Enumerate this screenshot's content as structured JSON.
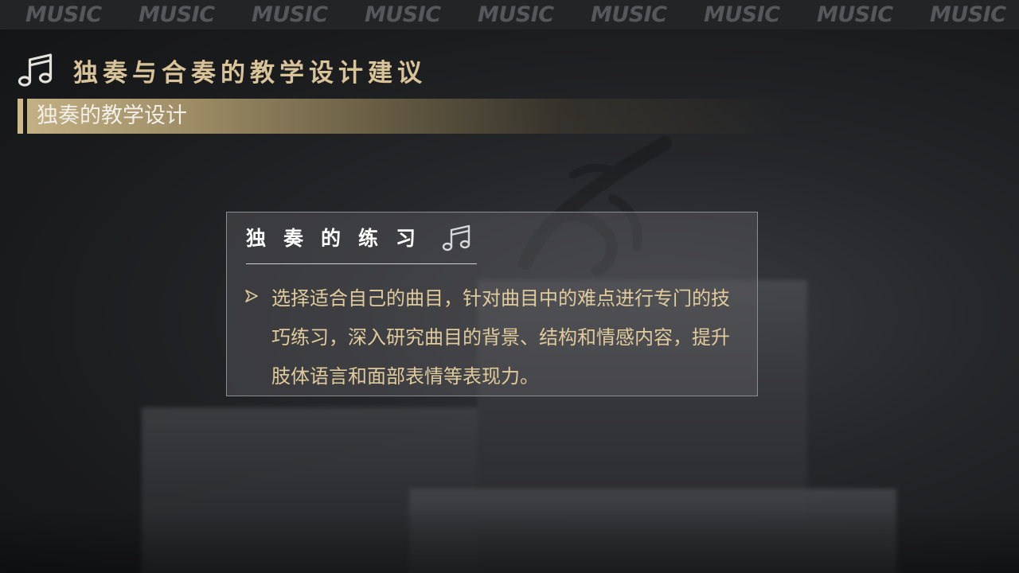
{
  "top_strip": {
    "words": [
      "MUSIC",
      "MUSIC",
      "MUSIC",
      "MUSIC",
      "MUSIC",
      "MUSIC",
      "MUSIC",
      "MUSIC",
      "MUSIC"
    ]
  },
  "header": {
    "icon": "music-note-icon",
    "title": "独奏与合奏的教学设计建议"
  },
  "section": {
    "title": "独奏的教学设计"
  },
  "card": {
    "title": "独奏的练习",
    "icon": "music-note-icon",
    "bullet_icon": "arrow-bullet-icon",
    "body": "选择适合自己的曲目，针对曲目中的难点进行专门的技巧练习，深入研究曲目的背景、结构和情感内容，提升肢体语言和面部表情等表现力。"
  },
  "colors": {
    "gold": "#d9c49a",
    "body_text": "#e0cb9c",
    "background": "#1a1b1d"
  }
}
